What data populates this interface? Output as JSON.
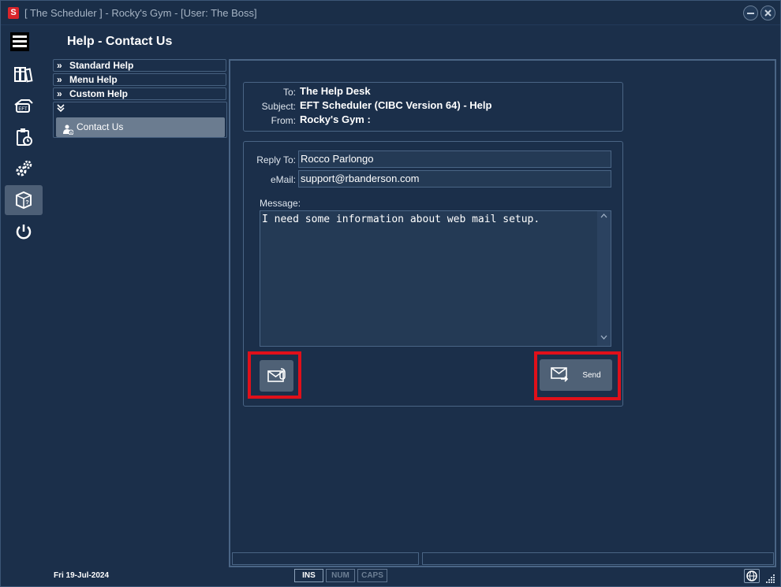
{
  "window": {
    "title": "[ The Scheduler ] - Rocky's Gym - [User: The Boss]",
    "app_icon": "S",
    "minimize_icon": "minimize-icon",
    "close_icon": "close-icon"
  },
  "page": {
    "title": "Help - Contact Us"
  },
  "rail": {
    "items": [
      {
        "icon": "menu-icon"
      },
      {
        "icon": "books-icon"
      },
      {
        "icon": "eft-payment-icon"
      },
      {
        "icon": "clipboard-icon"
      },
      {
        "icon": "gears-icon"
      },
      {
        "icon": "help-box-icon",
        "active": true
      },
      {
        "icon": "power-icon"
      }
    ]
  },
  "tree": {
    "items": [
      {
        "label": "Standard Help",
        "icon": "double-chevron-right-icon"
      },
      {
        "label": "Menu Help",
        "icon": "double-chevron-right-icon"
      },
      {
        "label": "Custom Help",
        "icon": "double-chevron-right-icon"
      }
    ],
    "expanded_group": {
      "icon": "double-chevron-down-icon",
      "child": {
        "label": "Contact Us",
        "icon": "person-info-icon"
      }
    }
  },
  "header_box": {
    "to_label": "To:",
    "to_value": "The Help Desk",
    "subject_label": "Subject:",
    "subject_value": "EFT Scheduler (CIBC Version 64) - Help",
    "from_label": "From:",
    "from_value": "Rocky's Gym :"
  },
  "form": {
    "reply_to_label": "Reply To:",
    "reply_to_value": "Rocco Parlongo",
    "email_label": "eMail:",
    "email_value": "support@rbanderson.com",
    "message_label": "Message:",
    "message_value": "I need some information about web mail setup.",
    "attach_icon": "mail-attach-icon",
    "send_label": "Send",
    "send_icon": "send-mail-icon",
    "highlight_color": "#e0101a"
  },
  "status": {
    "date": "Fri  19-Jul-2024",
    "keys": [
      {
        "label": "INS",
        "active": true
      },
      {
        "label": "NUM",
        "active": false
      },
      {
        "label": "CAPS",
        "active": false
      }
    ],
    "globe_icon": "globe-icon",
    "grip_icon": "resize-grip-icon"
  },
  "colors": {
    "background": "#1b2f4a",
    "panel_border": "#4a6585",
    "field_bg": "#243a55",
    "selected_item": "#6b7c90",
    "button_bg": "#4f6176"
  }
}
